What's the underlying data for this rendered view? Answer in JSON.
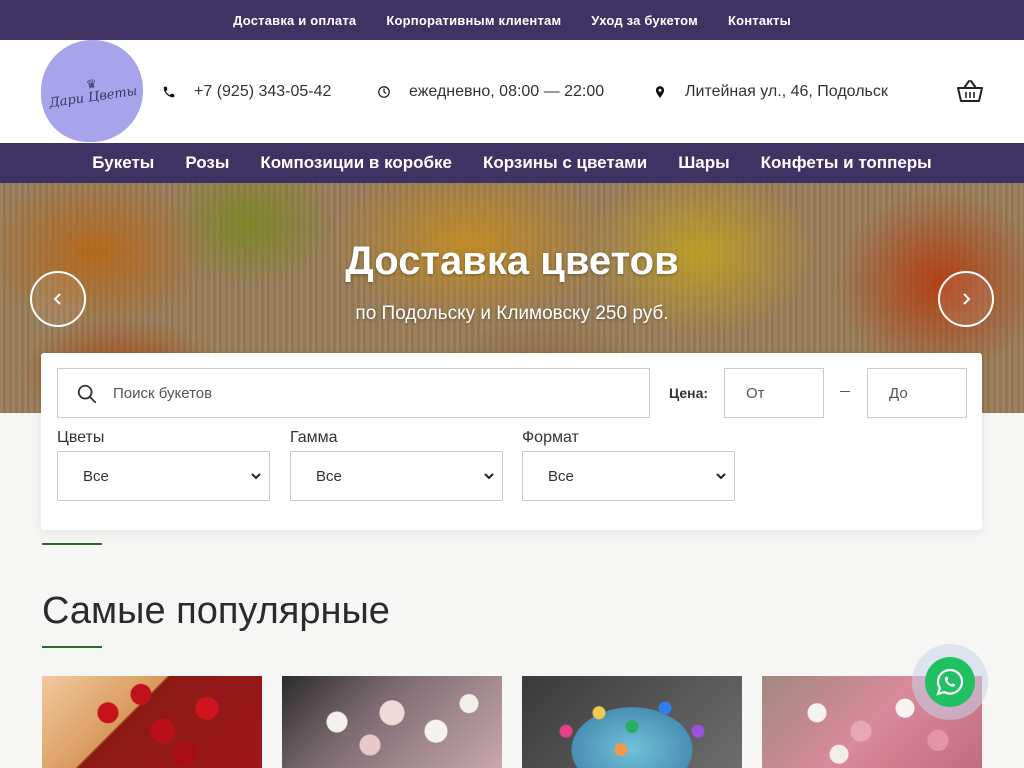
{
  "topbar": {
    "links": [
      {
        "label": "Доставка и оплата"
      },
      {
        "label": "Корпоративным клиентам"
      },
      {
        "label": "Уход за букетом"
      },
      {
        "label": "Контакты"
      }
    ]
  },
  "header": {
    "logo_text_line1": "Дари",
    "logo_text_line2": "Цветы",
    "phone": "+7 (925) 343-05-42",
    "hours": "ежедневно, 08:00 — 22:00",
    "address": "Литейная ул., 46, Подольск",
    "icons": {
      "phone": "phone-icon",
      "clock": "clock-icon",
      "pin": "location-pin-icon",
      "cart": "basket-icon"
    }
  },
  "nav": {
    "items": [
      {
        "label": "Букеты"
      },
      {
        "label": "Розы"
      },
      {
        "label": "Композиции в коробке"
      },
      {
        "label": "Корзины с цветами"
      },
      {
        "label": "Шары"
      },
      {
        "label": "Конфеты и топперы"
      }
    ]
  },
  "hero": {
    "title": "Доставка цветов",
    "subtitle": "по Подольску и Климовску 250 руб."
  },
  "filter": {
    "search_placeholder": "Поиск букетов",
    "price_label": "Цена:",
    "price_from_placeholder": "От",
    "price_to_placeholder": "До",
    "flowers_label": "Цветы",
    "flowers_value": "Все",
    "gamma_label": "Гамма",
    "gamma_value": "Все",
    "format_label": "Формат",
    "format_value": "Все"
  },
  "popular": {
    "title": "Самые популярные"
  },
  "colors": {
    "brand_purple": "#3e3363",
    "logo_lilac": "#a7a4ec",
    "accent_green": "#2e6a2e",
    "whatsapp_green": "#21c063"
  }
}
